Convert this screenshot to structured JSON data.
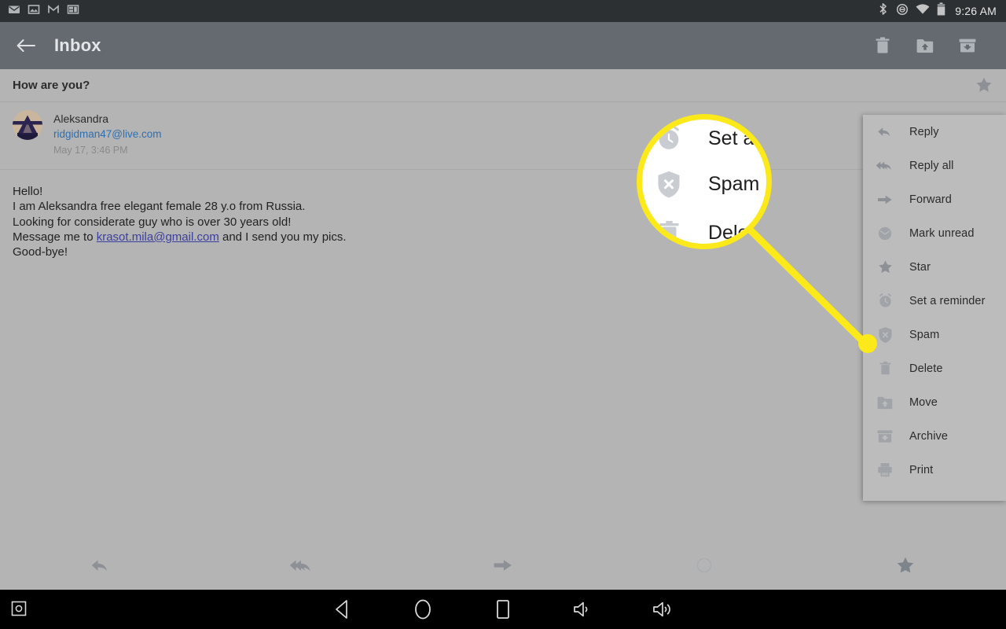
{
  "statusbar": {
    "time": "9:26 AM",
    "left_icons": [
      "mail-icon",
      "image-icon",
      "gmail-icon",
      "widget-icon"
    ],
    "right_icons": [
      "bluetooth-icon",
      "dnd-icon",
      "wifi-icon",
      "battery-icon"
    ]
  },
  "toolbar": {
    "back_label": "back-arrow-icon",
    "title": "Inbox",
    "actions": [
      {
        "name": "delete-button",
        "icon": "trash-icon"
      },
      {
        "name": "move-button",
        "icon": "folder-up-icon"
      },
      {
        "name": "archive-button",
        "icon": "archive-icon"
      }
    ]
  },
  "mail": {
    "subject": "How are you?",
    "star_icon": "star-icon",
    "sender_name": "Aleksandra",
    "sender_email": "ridgidman47@live.com",
    "date": "May 17, 3:46 PM",
    "body_lines": [
      "Hello!",
      "I am Aleksandra free elegant female 28 y.o from Russia.",
      "Looking for considerate guy who is over 30 years old!"
    ],
    "body_link_prefix": "Message me to ",
    "body_link": "krasot.mila@gmail.com",
    "body_link_suffix": " and I send you my pics.",
    "body_last_line": "Good-bye!"
  },
  "bottombar": {
    "items": [
      {
        "name": "reply-button",
        "icon": "reply-icon"
      },
      {
        "name": "reply-all-button",
        "icon": "reply-all-icon"
      },
      {
        "name": "forward-button",
        "icon": "forward-icon"
      },
      {
        "name": "mark-unread-button",
        "icon": "circle-icon"
      },
      {
        "name": "star-button",
        "icon": "star-icon"
      }
    ]
  },
  "menu": {
    "items": [
      {
        "label": "Reply",
        "icon": "reply-icon"
      },
      {
        "label": "Reply all",
        "icon": "reply-all-icon"
      },
      {
        "label": "Forward",
        "icon": "forward-icon"
      },
      {
        "label": "Mark unread",
        "icon": "circle-icon"
      },
      {
        "label": "Star",
        "icon": "star-icon"
      },
      {
        "label": "Set a reminder",
        "icon": "alarm-clock-icon"
      },
      {
        "label": "Spam",
        "icon": "shield-x-icon"
      },
      {
        "label": "Delete",
        "icon": "trash-icon"
      },
      {
        "label": "Move",
        "icon": "folder-up-icon"
      },
      {
        "label": "Archive",
        "icon": "archive-icon"
      },
      {
        "label": "Print",
        "icon": "printer-icon"
      }
    ]
  },
  "callout": {
    "highlight_color": "#fbe919",
    "target_label": "Spam",
    "magnified": [
      {
        "label": "Set a r",
        "icon": "alarm-clock-icon"
      },
      {
        "label": "Spam",
        "icon": "shield-x-icon"
      },
      {
        "label": "Delet",
        "icon": "trash-icon"
      }
    ]
  },
  "navbar": {
    "buttons": [
      {
        "name": "back-nav-button",
        "icon": "triangle-back-icon"
      },
      {
        "name": "home-nav-button",
        "icon": "circle-home-icon"
      },
      {
        "name": "recents-nav-button",
        "icon": "square-recents-icon"
      },
      {
        "name": "volume-down-button",
        "icon": "volume-low-icon"
      },
      {
        "name": "volume-up-button",
        "icon": "volume-high-icon"
      }
    ],
    "screenshot_icon": "camera-icon"
  }
}
